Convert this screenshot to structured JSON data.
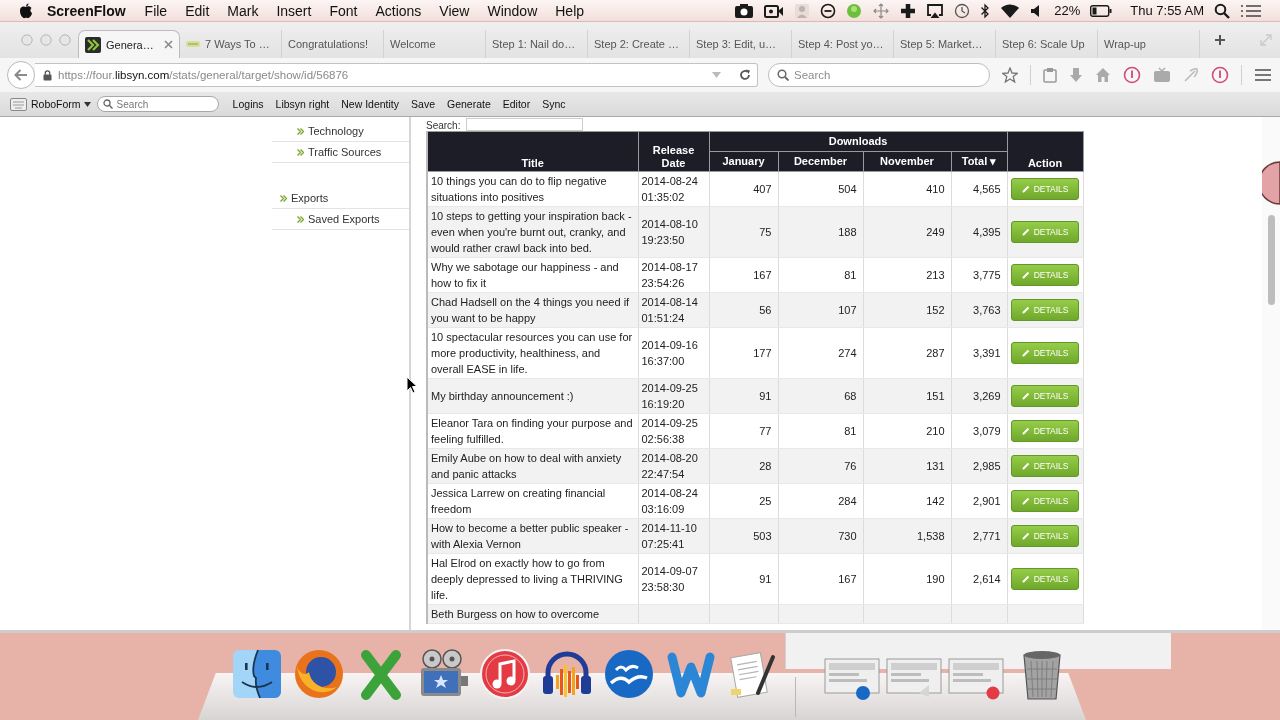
{
  "menu_bar": {
    "app_name": "ScreenFlow",
    "menus": [
      "File",
      "Edit",
      "Mark",
      "Insert",
      "Font",
      "Actions",
      "View",
      "Window",
      "Help"
    ],
    "battery_percent": "22%",
    "clock": "Thu 7:55 AM"
  },
  "tabs": [
    {
      "label": "Genera…",
      "selected": true,
      "favicon": true
    },
    {
      "label": "7 Ways To …",
      "selected": false,
      "favicon": true
    },
    {
      "label": "Congratulations!",
      "selected": false,
      "favicon": false
    },
    {
      "label": "Welcome",
      "selected": false,
      "favicon": false
    },
    {
      "label": "Step 1: Nail do…",
      "selected": false,
      "favicon": false
    },
    {
      "label": "Step 2: Create …",
      "selected": false,
      "favicon": false
    },
    {
      "label": "Step 3: Edit, u…",
      "selected": false,
      "favicon": false
    },
    {
      "label": "Step 4: Post yo…",
      "selected": false,
      "favicon": false
    },
    {
      "label": "Step 5: Market…",
      "selected": false,
      "favicon": false
    },
    {
      "label": "Step 6: Scale Up",
      "selected": false,
      "favicon": false
    },
    {
      "label": "Wrap-up",
      "selected": false,
      "favicon": false
    }
  ],
  "address_bar": {
    "url": "https://four.**libsyn.com**/stats/general/target/show/id/56876"
  },
  "search_field": {
    "placeholder": "Search"
  },
  "bookmarks_bar": {
    "menu_label": "RoboForm",
    "search_placeholder": "Search",
    "items": [
      "Logins",
      "Libsyn right",
      "New Identity",
      "Save",
      "Generate",
      "Editor",
      "Sync"
    ]
  },
  "sidebar": {
    "groups": [
      {
        "children": [
          {
            "label": "Technology"
          },
          {
            "label": "Traffic Sources"
          }
        ]
      },
      {
        "label": "Exports",
        "children": [
          {
            "label": "Saved Exports"
          }
        ]
      }
    ]
  },
  "table": {
    "search_label": "Search:",
    "columns": [
      {
        "label": "Title"
      },
      {
        "label": "Release Date"
      },
      {
        "label": "Downloads",
        "children": [
          {
            "label": "January"
          },
          {
            "label": "December"
          },
          {
            "label": "November"
          },
          {
            "label": "Total",
            "sort_mark": "▾"
          }
        ]
      },
      {
        "label": "Action"
      }
    ],
    "rows": [
      {
        "title": "10 things you can do to flip negative situations into positives",
        "release_date": "2014-08-24 01:35:02",
        "january": "407",
        "december": "504",
        "november": "410",
        "total": "4,565",
        "action": "DETAILS"
      },
      {
        "title": "10 steps to getting your inspiration back - even when you're burnt out, cranky, and would rather crawl back into bed.",
        "release_date": "2014-08-10 19:23:50",
        "january": "75",
        "december": "188",
        "november": "249",
        "total": "4,395",
        "action": "DETAILS"
      },
      {
        "title": "Why we sabotage our happiness - and how to fix it",
        "release_date": "2014-08-17 23:54:26",
        "january": "167",
        "december": "81",
        "november": "213",
        "total": "3,775",
        "action": "DETAILS"
      },
      {
        "title": "Chad Hadsell on the 4 things you need if you want to be happy",
        "release_date": "2014-08-14 01:51:24",
        "january": "56",
        "december": "107",
        "november": "152",
        "total": "3,763",
        "action": "DETAILS"
      },
      {
        "title": "10 spectacular resources you can use for more productivity, healthiness, and overall EASE in life.",
        "release_date": "2014-09-16 16:37:00",
        "january": "177",
        "december": "274",
        "november": "287",
        "total": "3,391",
        "action": "DETAILS"
      },
      {
        "title": "My birthday announcement :)",
        "release_date": "2014-09-25 16:19:20",
        "january": "91",
        "december": "68",
        "november": "151",
        "total": "3,269",
        "action": "DETAILS"
      },
      {
        "title": "Eleanor Tara on finding your purpose and feeling fulfilled.",
        "release_date": "2014-09-25 02:56:38",
        "january": "77",
        "december": "81",
        "november": "210",
        "total": "3,079",
        "action": "DETAILS"
      },
      {
        "title": "Emily Aube on how to deal with anxiety and panic attacks",
        "release_date": "2014-08-20 22:47:54",
        "january": "28",
        "december": "76",
        "november": "131",
        "total": "2,985",
        "action": "DETAILS"
      },
      {
        "title": "Jessica Larrew on creating financial freedom",
        "release_date": "2014-08-24 03:16:09",
        "january": "25",
        "december": "284",
        "november": "142",
        "total": "2,901",
        "action": "DETAILS"
      },
      {
        "title": "How to become a better public speaker - with Alexia Vernon",
        "release_date": "2014-11-10 07:25:41",
        "january": "503",
        "december": "730",
        "november": "1,538",
        "total": "2,771",
        "action": "DETAILS"
      },
      {
        "title": "Hal Elrod on exactly how to go from deeply depressed to living a THRIVING life.",
        "release_date": "2014-09-07 23:58:30",
        "january": "91",
        "december": "167",
        "november": "190",
        "total": "2,614",
        "action": "DETAILS"
      },
      {
        "title": "Beth Burgess on how to overcome"
      }
    ]
  }
}
